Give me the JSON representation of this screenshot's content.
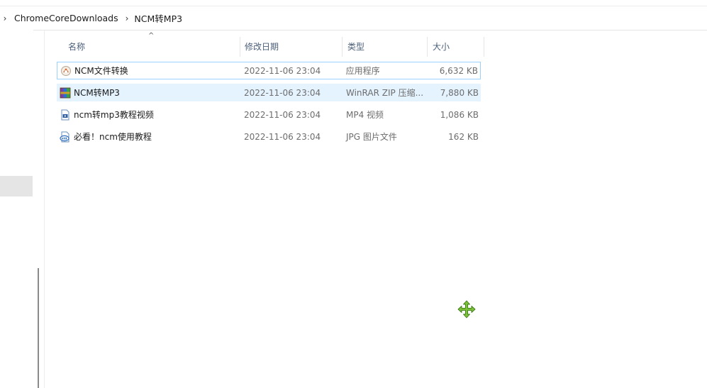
{
  "breadcrumb": {
    "items": [
      "ChromeCoreDownloads",
      "NCM转MP3"
    ]
  },
  "columns": {
    "name": "名称",
    "date": "修改日期",
    "type": "类型",
    "size": "大小"
  },
  "files": [
    {
      "name": "NCM文件转换",
      "date": "2022-11-06 23:04",
      "type": "应用程序",
      "size": "6,632 KB",
      "icon": "app-icon"
    },
    {
      "name": "NCM转MP3",
      "date": "2022-11-06 23:04",
      "type": "WinRAR ZIP 压缩...",
      "size": "7,880 KB",
      "icon": "winrar-archive-icon"
    },
    {
      "name": "ncm转mp3教程视频",
      "date": "2022-11-06 23:04",
      "type": "MP4 视频",
      "size": "1,086 KB",
      "icon": "video-file-icon"
    },
    {
      "name": "必看！ncm使用教程",
      "date": "2022-11-06 23:04",
      "type": "JPG 图片文件",
      "size": "162 KB",
      "icon": "jpg-file-icon"
    }
  ],
  "colors": {
    "selection": "#cce8ff",
    "hover": "#e5f3ff",
    "focus_border": "#99d1ff",
    "header_text": "#4c607a",
    "cursor": "#7cc13a"
  }
}
